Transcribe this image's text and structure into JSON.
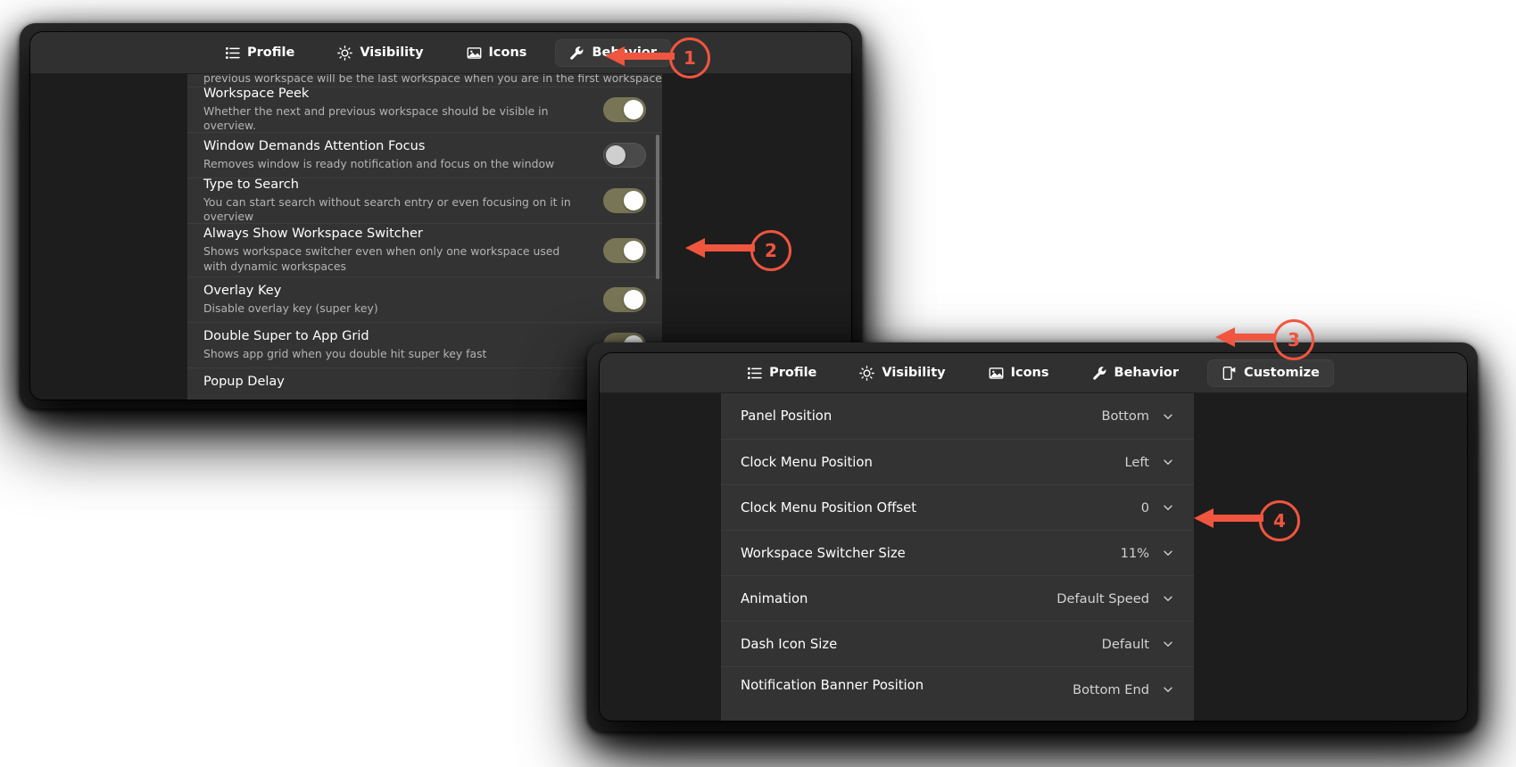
{
  "app": {
    "accent_toggle_on": "#787556",
    "accent_annotation": "#f0553f",
    "window_bg": "#242424",
    "header_bg": "#303030",
    "list_bg": "#333333"
  },
  "window_behavior": {
    "tabs": [
      {
        "label": "Profile",
        "icon": "list-icon",
        "active": false
      },
      {
        "label": "Visibility",
        "icon": "sun-icon",
        "active": false
      },
      {
        "label": "Icons",
        "icon": "image-icon",
        "active": false
      },
      {
        "label": "Behavior",
        "icon": "wrench-icon",
        "active": true
      }
    ],
    "clipped_top_text": "previous workspace will be the last workspace when you are in the first workspace.",
    "rows": [
      {
        "title": "Workspace Peek",
        "subtitle": "Whether the next and previous workspace should be visible in overview.",
        "control": "toggle",
        "state": "on"
      },
      {
        "title": "Window Demands Attention Focus",
        "subtitle": "Removes window is ready notification and focus on the window",
        "control": "toggle",
        "state": "off"
      },
      {
        "title": "Type to Search",
        "subtitle": "You can start search without search entry or even focusing on it in overview",
        "control": "toggle",
        "state": "on"
      },
      {
        "title": "Always Show Workspace Switcher",
        "subtitle": "Shows workspace switcher even when only one workspace used with dynamic workspaces",
        "control": "toggle",
        "state": "on"
      },
      {
        "title": "Overlay Key",
        "subtitle": "Disable overlay key (super key)",
        "control": "toggle",
        "state": "on"
      },
      {
        "title": "Double Super to App Grid",
        "subtitle": "Shows app grid when you double hit super key fast",
        "control": "toggle",
        "state": "on"
      }
    ],
    "clipped_bottom_text": "Popup Delay"
  },
  "window_customize": {
    "tabs": [
      {
        "label": "Profile",
        "icon": "list-icon",
        "active": false
      },
      {
        "label": "Visibility",
        "icon": "sun-icon",
        "active": false
      },
      {
        "label": "Icons",
        "icon": "image-icon",
        "active": false
      },
      {
        "label": "Behavior",
        "icon": "wrench-icon",
        "active": false
      },
      {
        "label": "Customize",
        "icon": "customize-icon",
        "active": true
      }
    ],
    "rows": [
      {
        "label": "Panel Position",
        "value": "Bottom"
      },
      {
        "label": "Clock Menu Position",
        "value": "Left"
      },
      {
        "label": "Clock Menu Position Offset",
        "value": "0"
      },
      {
        "label": "Workspace Switcher Size",
        "value": "11%"
      },
      {
        "label": "Animation",
        "value": "Default Speed"
      },
      {
        "label": "Dash Icon Size",
        "value": "Default"
      },
      {
        "label": "Notification Banner Position",
        "value": "Bottom End"
      }
    ]
  },
  "annotations": [
    {
      "number": "1",
      "target": "behavior-tab"
    },
    {
      "number": "2",
      "target": "always-show-workspace-switcher-toggle"
    },
    {
      "number": "3",
      "target": "customize-tab"
    },
    {
      "number": "4",
      "target": "workspace-switcher-size-combo"
    }
  ]
}
